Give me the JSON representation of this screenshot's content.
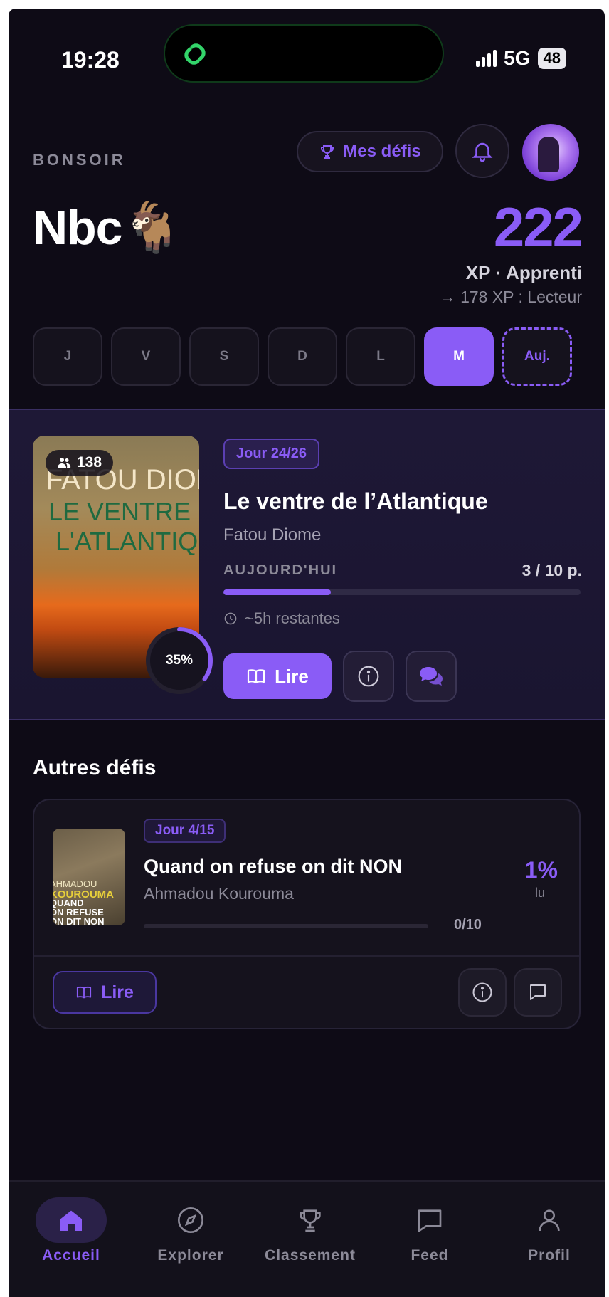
{
  "status_bar": {
    "time": "19:28",
    "network": "5G",
    "battery": "48"
  },
  "header": {
    "greeting": "BONSOIR",
    "challenges_button": "Mes défis",
    "user_name": "Nbc🐐",
    "xp_value": "222",
    "xp_level": "XP · Apprenti",
    "xp_next": "→ 178 XP : Lecteur"
  },
  "days": [
    "J",
    "V",
    "S",
    "D",
    "L",
    "M",
    "Auj."
  ],
  "current_challenge": {
    "cover_line1": "FATOU DIOME",
    "cover_line2": "LE VENTRE D",
    "cover_line3": "L'ATLANTIQU",
    "readers": "138",
    "progress_label": "35%",
    "progress": 0.35,
    "day_badge": "Jour 24/26",
    "title": "Le ventre de l’Atlantique",
    "author": "Fatou Diome",
    "today_label": "AUJOURD'HUI",
    "pages": "3 / 10 p.",
    "today_progress": 0.3,
    "remaining": "~5h restantes",
    "read_button": "Lire"
  },
  "other_challenges": {
    "section_title": "Autres défis",
    "items": [
      {
        "cover_line1": "AHMADOU",
        "cover_line2": "KOUROUMA",
        "cover_line3": "QUAND\nON REFUSE\nON DIT NON",
        "day_badge": "Jour 4/15",
        "title": "Quand on refuse on dit NON",
        "author": "Ahmadou Kourouma",
        "pages": "0/10",
        "percent": "1%",
        "percent_label": "lu",
        "read_button": "Lire"
      }
    ]
  },
  "tabbar": [
    {
      "label": "Accueil",
      "icon": "home-icon",
      "active": true
    },
    {
      "label": "Explorer",
      "icon": "compass-icon",
      "active": false
    },
    {
      "label": "Classement",
      "icon": "trophy-icon",
      "active": false
    },
    {
      "label": "Feed",
      "icon": "chat-icon",
      "active": false
    },
    {
      "label": "Profil",
      "icon": "user-icon",
      "active": false
    }
  ],
  "colors": {
    "accent": "#8a5cf6",
    "background": "#0e0b16",
    "card": "#1e1836"
  }
}
